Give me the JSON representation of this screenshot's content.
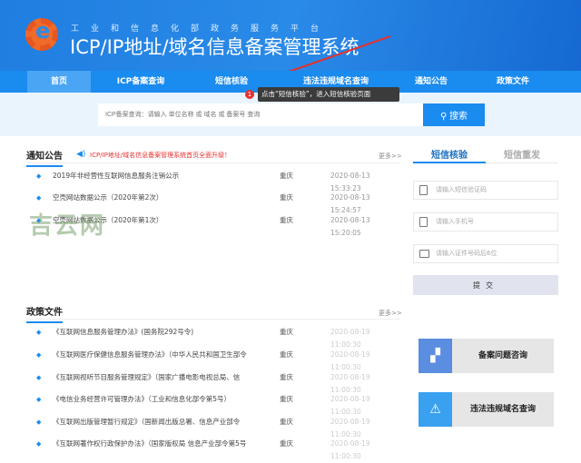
{
  "header": {
    "subtitle": "工业和信息化部政务服务平台",
    "title": "ICP/IP地址/域名信息备案管理系统"
  },
  "nav": {
    "items": [
      {
        "label": "首页",
        "active": true
      },
      {
        "label": "ICP备案查询"
      },
      {
        "label": "短信核验"
      },
      {
        "label": "违法违规域名查询"
      },
      {
        "label": "通知公告"
      },
      {
        "label": "政策文件"
      }
    ]
  },
  "search": {
    "placeholder": "ICP备案查询：请输入 单位名称 或 域名 或 备案号 查询",
    "button": "搜索"
  },
  "tooltip": {
    "step": "1",
    "text": "点击“短信核验”，进入短信核验页面"
  },
  "notice": {
    "title": "通知公告",
    "marquee": "ICP/IP地址/域名信息备案管理系统首页全面升级！",
    "more": "更多>>",
    "rows": [
      {
        "title": "2019年非经营性互联网信息服务注销公示",
        "city": "重庆",
        "date": "2020-08-13 15:33:23"
      },
      {
        "title": "空壳网站数据公示（2020年第2次）",
        "city": "重庆",
        "date": "2020-08-13 15:24:57"
      },
      {
        "title": "空壳网站数据公示（2020年第1次）",
        "city": "重庆",
        "date": "2020-08-13 15:20:05"
      }
    ]
  },
  "policy": {
    "title": "政策文件",
    "more": "更多>>",
    "rows": [
      {
        "title": "《互联网信息服务管理办法》(国务院292号令)",
        "city": "重庆",
        "date": "2020-08-19 11:00:30"
      },
      {
        "title": "《互联网医疗保健信息服务管理办法》（中华人民共和国卫生部令",
        "city": "重庆",
        "date": "2020-08-19 11:00:30"
      },
      {
        "title": "《互联网视听节目服务管理规定》（国家广播电影电视总局、信",
        "city": "重庆",
        "date": "2020-08-19 11:00:30"
      },
      {
        "title": "《电信业务经营许可管理办法》（工业和信息化部令第5号）",
        "city": "重庆",
        "date": "2020-08-19 11:00:30"
      },
      {
        "title": "《互联网出版管理暂行规定》（国新闻出版总署、信息产业部令",
        "city": "重庆",
        "date": "2020-08-19 11:00:30"
      },
      {
        "title": "《互联网著作权行政保护办法》（国家版权局 信息产业部令第5号",
        "city": "重庆",
        "date": "2020-08-19 11:00:30"
      }
    ]
  },
  "sms": {
    "tabs": [
      "短信核验",
      "短信重发"
    ],
    "code_placeholder": "请输入短信验证码",
    "phone_placeholder": "请输入手机号",
    "id_placeholder": "请输入证件号码后6位",
    "submit": "提交"
  },
  "cards": [
    {
      "label": "备案问题咨询",
      "color": "#5b8de0",
      "icon": "consult-icon"
    },
    {
      "label": "违法违规域名查询",
      "color": "#3aa0f0",
      "icon": "warning-icon"
    }
  ],
  "watermark": "吉云网",
  "colors": {
    "primary": "#1a8bef",
    "annotation": "#e5312f"
  }
}
